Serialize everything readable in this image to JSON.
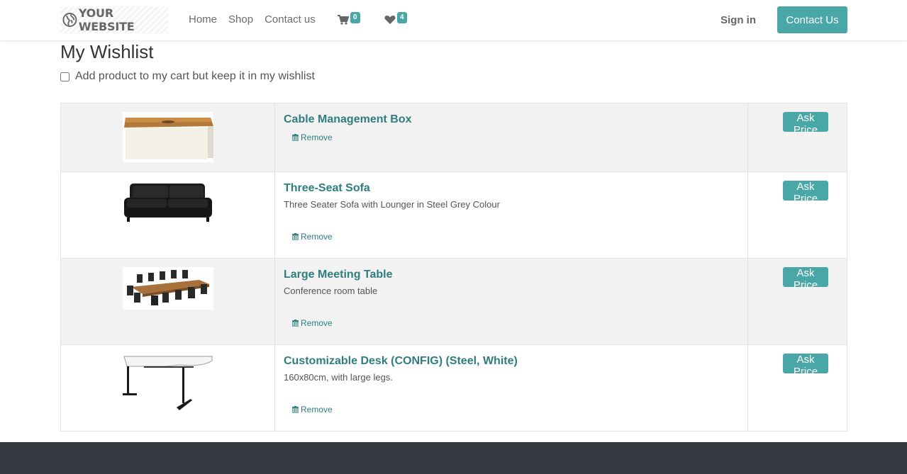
{
  "header": {
    "logo_text": "YOUR WEBSITE",
    "nav": [
      "Home",
      "Shop",
      "Contact us"
    ],
    "cart_count": "0",
    "wishlist_count": "4",
    "signin_label": "Sign in",
    "contact_button": "Contact Us"
  },
  "main": {
    "title": "My Wishlist",
    "keep_in_wishlist_label": "Add product to my cart but keep it in my wishlist",
    "keep_in_wishlist_checked": false,
    "remove_label": "Remove",
    "ask_price_label": "Ask Price",
    "items": [
      {
        "name": "Cable Management Box",
        "description": "",
        "image": "cable-box-image"
      },
      {
        "name": "Three-Seat Sofa",
        "description": "Three Seater Sofa with Lounger in Steel Grey Colour",
        "image": "sofa-image"
      },
      {
        "name": "Large Meeting Table",
        "description": "Conference room table",
        "image": "meeting-table-image"
      },
      {
        "name": "Customizable Desk (CONFIG) (Steel, White)",
        "description": "160x80cm, with large legs.",
        "image": "desk-image"
      }
    ]
  },
  "colors": {
    "accent": "#4aa7a7",
    "link": "#2f7d7e",
    "footer": "#343a40"
  }
}
